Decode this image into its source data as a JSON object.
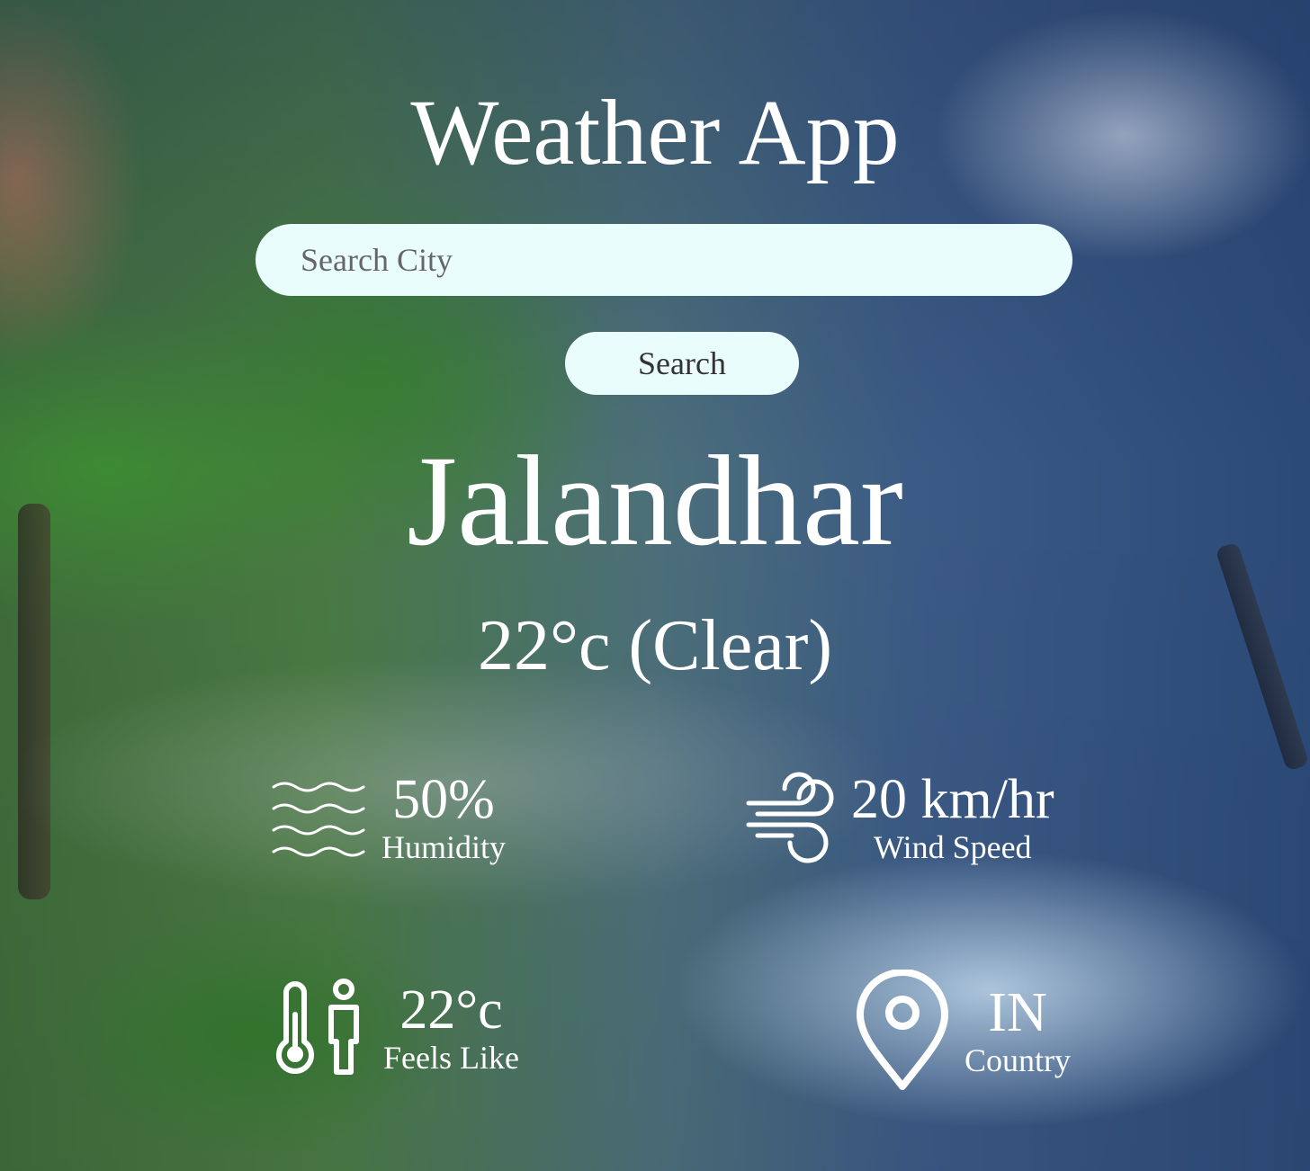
{
  "app": {
    "title": "Weather App"
  },
  "search": {
    "placeholder": "Search City",
    "value": "",
    "button_label": "Search"
  },
  "weather": {
    "city": "Jalandhar",
    "temperature_summary": "22°c (Clear)"
  },
  "details": {
    "humidity": {
      "value": "50%",
      "label": "Humidity",
      "icon": "humidity-waves-icon"
    },
    "wind": {
      "value": "20 km/hr",
      "label": "Wind Speed",
      "icon": "wind-icon"
    },
    "feels_like": {
      "value": "22°c",
      "label": "Feels Like",
      "icon": "thermometer-person-icon"
    },
    "country": {
      "value": "IN",
      "label": "Country",
      "icon": "location-pin-icon"
    }
  },
  "colors": {
    "text": "#ffffff",
    "input_background": "#e9fdfd",
    "input_text": "#333333"
  }
}
